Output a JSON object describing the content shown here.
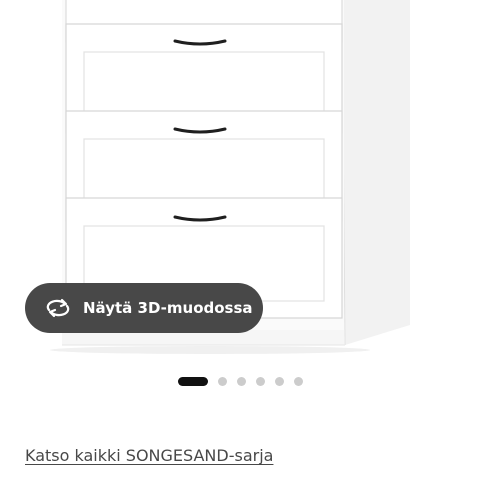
{
  "product": {
    "image_alt": "SONGESAND",
    "view3d_label": "Näytä 3D-muodossa"
  },
  "carousel": {
    "dot_count": 6,
    "active_index": 0
  },
  "series_link": {
    "label": "Katso kaikki SONGESAND-sarja"
  },
  "colors": {
    "button_bg": "#484848",
    "dot_active": "#111111",
    "dot_inactive": "#cccccc",
    "link_text": "#484848"
  },
  "icons": {
    "view3d": "rotate-arrows-icon",
    "handle": "drawer-handle-icon"
  }
}
